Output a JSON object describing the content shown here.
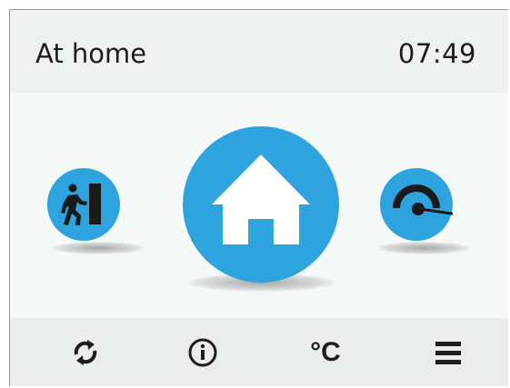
{
  "header": {
    "mode_label": "At home",
    "clock": "07:49"
  },
  "modes": [
    {
      "id": "away",
      "icon": "away-exit-icon"
    },
    {
      "id": "home",
      "icon": "home-icon",
      "active": true
    },
    {
      "id": "boost",
      "icon": "speedometer-icon"
    }
  ],
  "footer": {
    "buttons": [
      {
        "id": "refresh",
        "icon": "refresh-icon"
      },
      {
        "id": "info",
        "icon": "info-icon"
      },
      {
        "id": "temperature",
        "icon": "celsius-icon",
        "text": "°C"
      },
      {
        "id": "menu",
        "icon": "hamburger-menu-icon"
      }
    ]
  },
  "colors": {
    "accent": "#2ea3de",
    "text": "#1d1d1d",
    "header_bg": "#eef1ef",
    "main_bg": "#f4f8f6",
    "footer_bg": "#eaedeb"
  }
}
